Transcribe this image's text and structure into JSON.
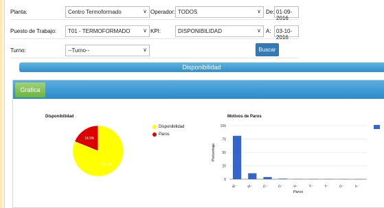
{
  "filters": {
    "planta_label": "Planta:",
    "planta_value": "Centro Termoformado",
    "operador_label": "Operador:",
    "operador_value": "TODOS",
    "de_label": "De:",
    "de_value": "01-09-2016",
    "puesto_label": "Puesto de Trabajo:",
    "puesto_value": "T01 - TERMOFORMADO",
    "kpi_label": "KPI:",
    "kpi_value": "DISPONIBILIDAD",
    "a_label": "A:",
    "a_value": "03-10-2016",
    "turno_label": "Turno:",
    "turno_value": "--Turno--",
    "buscar_label": "Buscar",
    "chevron": "∨"
  },
  "section_title": "Disponibilidad",
  "tab_label": "Grafica",
  "colors": {
    "accent_blue": "#2f8ecb",
    "button_blue": "#337ab7",
    "tab_green": "#6cb33f",
    "pie_yellow": "#ffff00",
    "pie_red": "#dd0000",
    "bar_blue": "#3366cc"
  },
  "chart_data": [
    {
      "type": "pie",
      "title": "Disponibilidad",
      "slices": [
        {
          "label": "Disponibilidad",
          "value": 81.1,
          "text": "81.1%",
          "color": "#ffff00"
        },
        {
          "label": "Paros",
          "value": 18.9,
          "text": "18.9%",
          "color": "#dd0000"
        }
      ]
    },
    {
      "type": "bar",
      "title": "Motivos de Paros",
      "xlabel": "Paros",
      "ylabel": "Porcentaje",
      "ylim": [
        0,
        100
      ],
      "yticks": [
        "0",
        "25",
        "50",
        "75",
        "100"
      ],
      "categories": [
        "M..",
        "M..",
        "O..",
        "O..",
        "N..",
        "F..",
        "F..",
        "O..",
        "A.."
      ],
      "values": [
        81,
        11,
        4,
        1,
        0.5,
        0.3,
        0.2,
        0.1,
        0.1
      ],
      "legend_color": "#3366cc"
    }
  ]
}
